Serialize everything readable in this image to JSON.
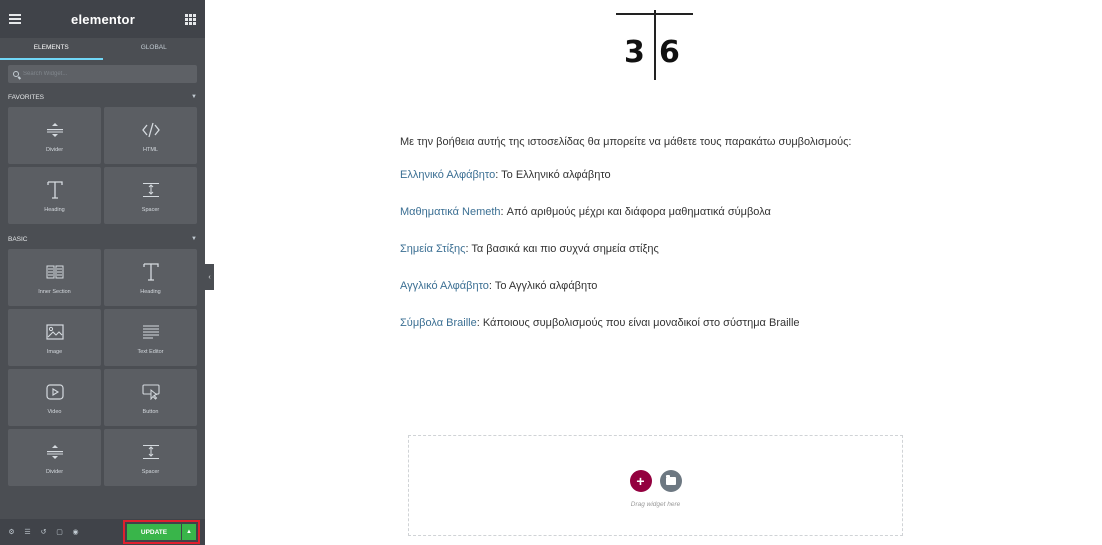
{
  "sidebar": {
    "logo": "elementor",
    "tabs": [
      {
        "label": "ELEMENTS",
        "active": true
      },
      {
        "label": "GLOBAL",
        "active": false
      }
    ],
    "search_placeholder": "Search Widget...",
    "categories": [
      {
        "title": "FAVORITES",
        "widgets": [
          {
            "label": "Divider",
            "icon": "divider-icon"
          },
          {
            "label": "HTML",
            "icon": "code-icon"
          },
          {
            "label": "Heading",
            "icon": "heading-icon"
          },
          {
            "label": "Spacer",
            "icon": "spacer-icon"
          }
        ]
      },
      {
        "title": "BASIC",
        "widgets": [
          {
            "label": "Inner Section",
            "icon": "columns-icon"
          },
          {
            "label": "Heading",
            "icon": "heading-icon"
          },
          {
            "label": "Image",
            "icon": "image-icon"
          },
          {
            "label": "Text Editor",
            "icon": "text-editor-icon"
          },
          {
            "label": "Video",
            "icon": "video-icon"
          },
          {
            "label": "Button",
            "icon": "button-icon"
          },
          {
            "label": "Divider",
            "icon": "divider-icon"
          },
          {
            "label": "Spacer",
            "icon": "spacer-icon"
          }
        ]
      }
    ],
    "footer": {
      "update_label": "UPDATE",
      "icons": [
        "settings-icon",
        "navigator-icon",
        "history-icon",
        "responsive-icon",
        "preview-icon"
      ]
    }
  },
  "content": {
    "logo_left": "3",
    "logo_right": "6",
    "intro": "Με την βοήθεια αυτής της ιστοσελίδας θα μπορείτε να μάθετε τους παρακάτω συμβολισμούς:",
    "links": [
      {
        "link": "Ελληνικό Αλφάβητο",
        "text": ": Το Ελληνικό αλφάβητο"
      },
      {
        "link": "Μαθηματικά Nemeth",
        "text": ": Από αριθμούς μέχρι και διάφορα μαθηματικά σύμβολα"
      },
      {
        "link": "Σημεία Στίξης",
        "text": ": Τα βασικά και πιο συχνά σημεία στίξης"
      },
      {
        "link": "Αγγλικό Αλφάβητο",
        "text": ": Το Αγγλικό αλφάβητο"
      },
      {
        "link": "Σύμβολα Braille",
        "text": ": Κάποιους συμβολισμούς που είναι μοναδικοί στο σύστημα Braille"
      }
    ],
    "dropzone_text": "Drag widget here"
  },
  "colors": {
    "update_green": "#39b54a",
    "add_button": "#93003f",
    "link": "#3b6f93",
    "highlight_border": "#e0202e"
  }
}
